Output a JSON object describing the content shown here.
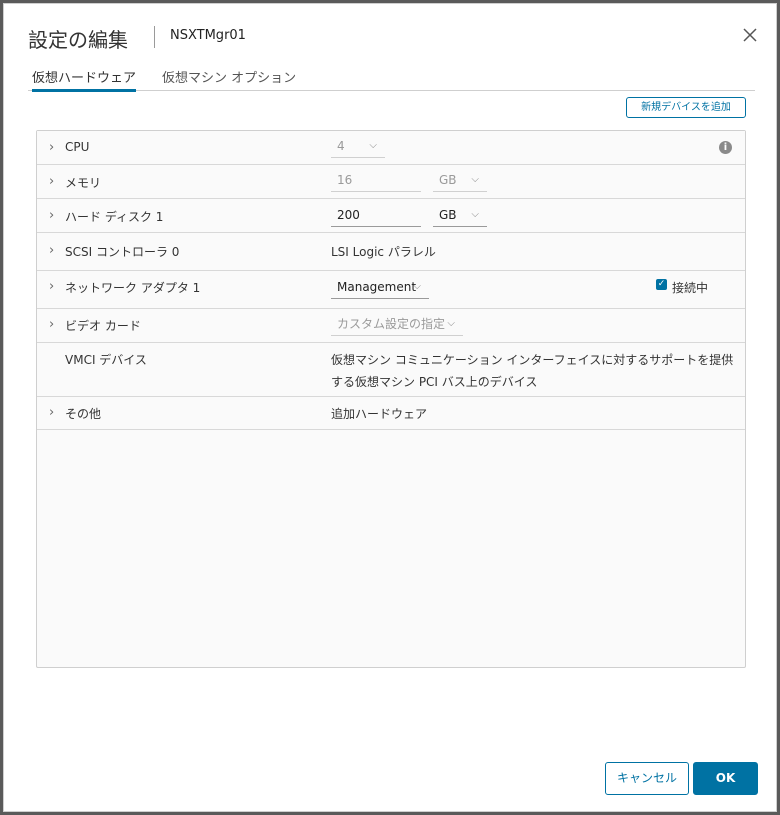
{
  "dialog": {
    "title": "設定の編集",
    "vm_name": "NSXTMgr01",
    "tabs": [
      {
        "label": "仮想ハードウェア",
        "active": true
      },
      {
        "label": "仮想マシン オプション",
        "active": false
      }
    ],
    "add_device_label": "新規デバイスを追加",
    "cancel_label": "キャンセル",
    "ok_label": "OK",
    "accent_color": "#0072a3"
  },
  "hardware": {
    "cpu": {
      "label": "CPU",
      "value": "4"
    },
    "memory": {
      "label": "メモリ",
      "value": "16",
      "unit": "GB"
    },
    "disk": {
      "label": "ハード ディスク 1",
      "value": "200",
      "unit": "GB"
    },
    "scsi": {
      "label": "SCSI コントローラ 0",
      "value": "LSI Logic パラレル"
    },
    "network": {
      "label": "ネットワーク アダプタ 1",
      "value": "Management",
      "connected_label": "接続中",
      "connected": true
    },
    "video": {
      "label": "ビデオ カード",
      "value": "カスタム設定の指定"
    },
    "vmci": {
      "label": "VMCI デバイス",
      "description_line1": "仮想マシン コミュニケーション インターフェイスに対するサポートを提供",
      "description_line2": "する仮想マシン PCI バス上のデバイス"
    },
    "other": {
      "label": "その他",
      "value": "追加ハードウェア"
    }
  }
}
